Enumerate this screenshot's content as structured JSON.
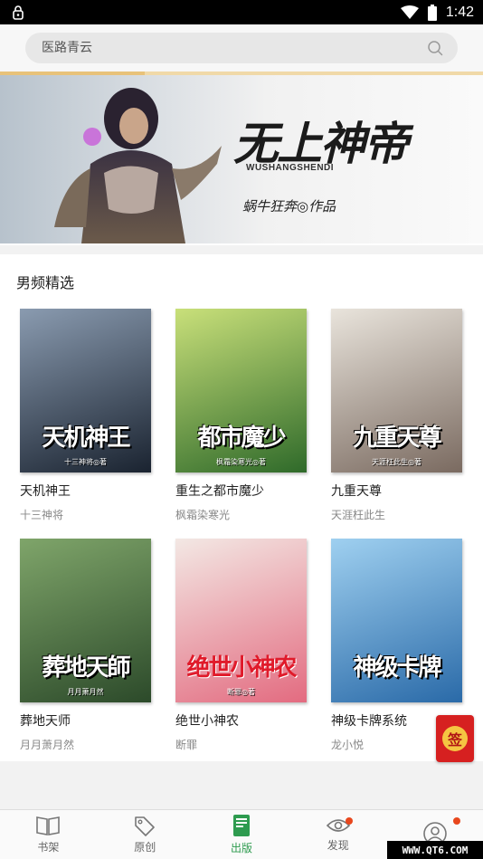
{
  "status": {
    "time": "1:42"
  },
  "search": {
    "placeholder": "医路青云"
  },
  "banner": {
    "progress": 0.3,
    "title": "无上神帝",
    "pinyin": "WUSHANGSHENDI",
    "author_line": "蜗牛狂奔◎作品"
  },
  "section": {
    "title": "男频精选",
    "books": [
      {
        "name": "天机神王",
        "author": "十三神将",
        "cover_text": "天机神王",
        "cover_author": "十三神将◎著",
        "colors": [
          "#8a9bb0",
          "#1a2330"
        ]
      },
      {
        "name": "重生之都市魔少",
        "author": "枫霜染寒光",
        "cover_text": "都市魔少",
        "cover_author": "枫霜染寒光◎著",
        "colors": [
          "#c9e07a",
          "#2f6a2a"
        ]
      },
      {
        "name": "九重天尊",
        "author": "天涯枉此生",
        "cover_text": "九重天尊",
        "cover_author": "天涯枉此生◎著",
        "colors": [
          "#e9e4dc",
          "#7a6a60"
        ]
      },
      {
        "name": "葬地天师",
        "author": "月月萧月然",
        "cover_text": "葬地天師",
        "cover_author": "月月萧月然",
        "colors": [
          "#7fa56a",
          "#2c4a2a"
        ]
      },
      {
        "name": "绝世小神农",
        "author": "断罪",
        "cover_text": "绝世小神农",
        "cover_author": "断罪◎著",
        "colors": [
          "#f3e8e4",
          "#e36b80"
        ]
      },
      {
        "name": "神级卡牌系统",
        "author": "龙小悦",
        "cover_text": "神级卡牌",
        "cover_author": "",
        "colors": [
          "#9fd0f0",
          "#2a6aa8"
        ]
      }
    ]
  },
  "qiandao": {
    "label": "签"
  },
  "tabs": [
    {
      "label": "书架",
      "icon": "book-open-icon",
      "active": false,
      "dot": false
    },
    {
      "label": "原创",
      "icon": "tag-icon",
      "active": false,
      "dot": false
    },
    {
      "label": "出版",
      "icon": "book-green-icon",
      "active": true,
      "dot": false
    },
    {
      "label": "发现",
      "icon": "eye-icon",
      "active": false,
      "dot": true
    },
    {
      "label": "",
      "icon": "user-icon",
      "active": false,
      "dot": true
    }
  ],
  "watermark": "WWW.QT6.COM"
}
